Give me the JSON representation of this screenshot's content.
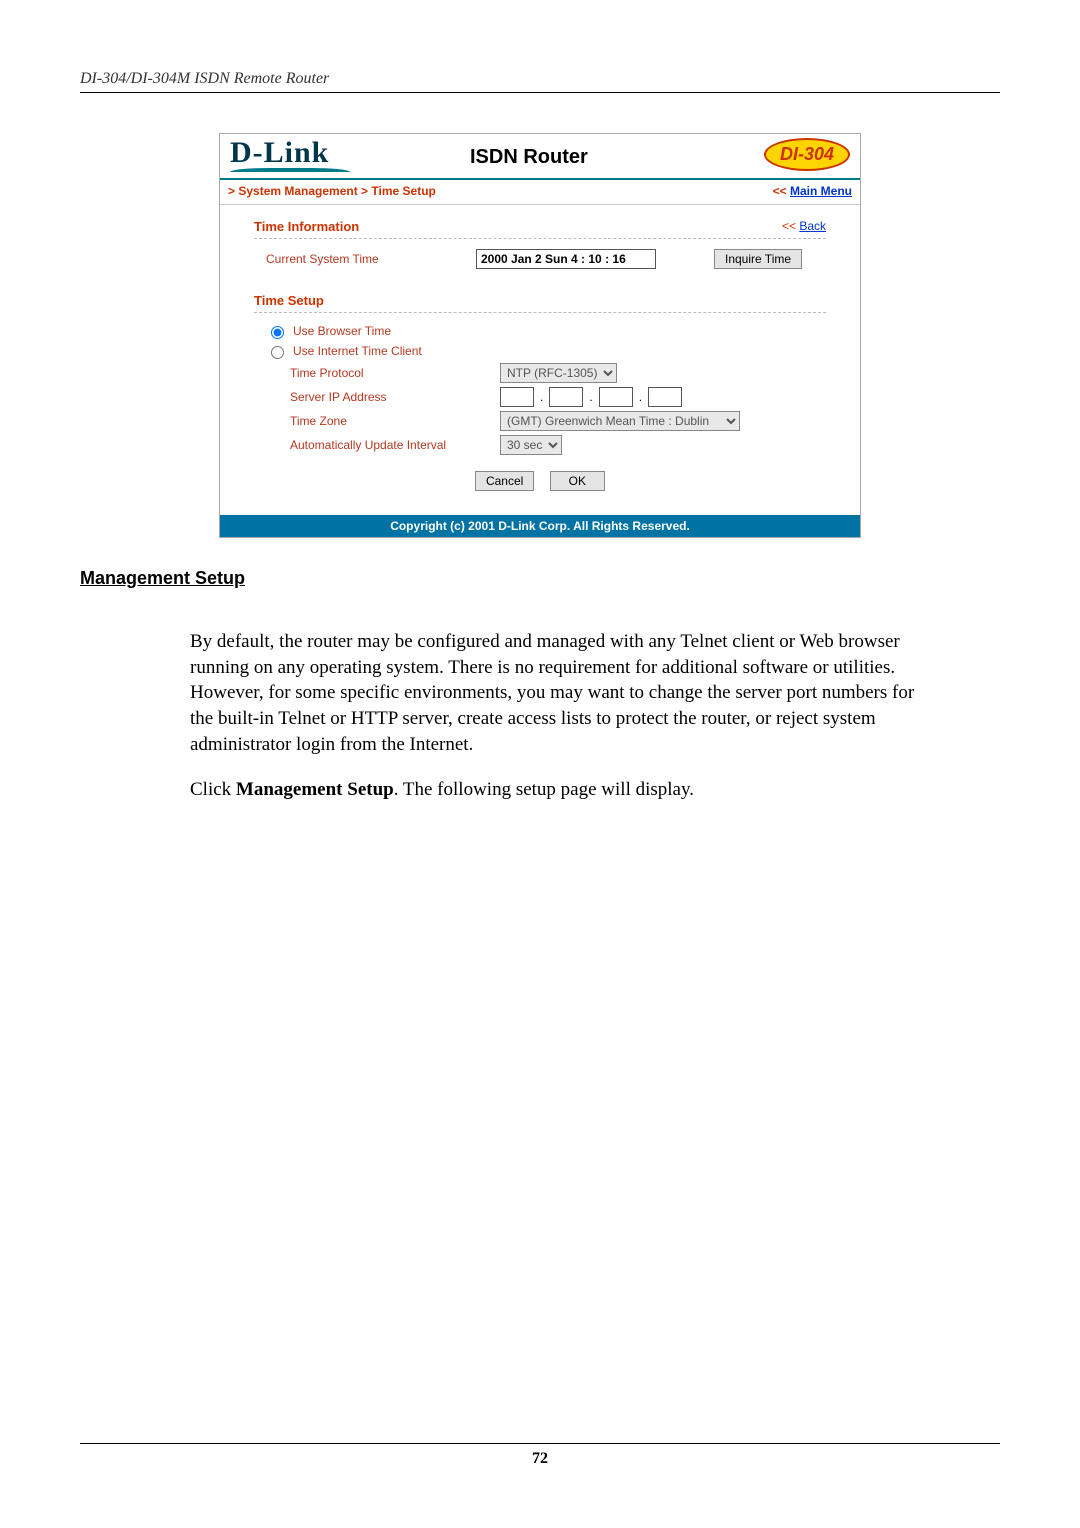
{
  "doc": {
    "header": "DI-304/DI-304M ISDN Remote Router",
    "page_number": "72",
    "heading": "Management Setup",
    "para1": "By default, the router may be configured and managed with any Telnet client or Web browser running on any operating system. There is no requirement for additional software or utilities. However, for some specific environments, you may want to change the server port numbers for the built-in Telnet or HTTP server, create access lists to protect the router, or reject system administrator login from the Internet.",
    "para2_prefix": "Click ",
    "para2_bold": "Management Setup",
    "para2_suffix": ". The following setup page will display."
  },
  "ui": {
    "brand": "D-Link",
    "product_title": "ISDN Router",
    "model": "DI-304",
    "breadcrumb": "> System Management > Time Setup",
    "main_menu_prefix": "<< ",
    "main_menu_label": "Main Menu",
    "section1": {
      "title": "Time Information",
      "back_prefix": "<< ",
      "back_label": "Back",
      "row_label": "Current System Time",
      "time_value": "2000 Jan 2 Sun 4 : 10 : 16",
      "inquire_btn": "Inquire Time"
    },
    "section2": {
      "title": "Time Setup",
      "radio1": "Use Browser Time",
      "radio2": "Use Internet Time Client",
      "time_protocol_label": "Time Protocol",
      "time_protocol_value": "NTP (RFC-1305)",
      "server_ip_label": "Server IP Address",
      "ip": [
        "",
        "",
        "",
        ""
      ],
      "tz_label": "Time Zone",
      "tz_value": "(GMT) Greenwich Mean Time : Dublin",
      "interval_label": "Automatically Update Interval",
      "interval_value": "30 sec",
      "cancel": "Cancel",
      "ok": "OK"
    },
    "footer": "Copyright (c) 2001 D-Link Corp. All Rights Reserved."
  }
}
